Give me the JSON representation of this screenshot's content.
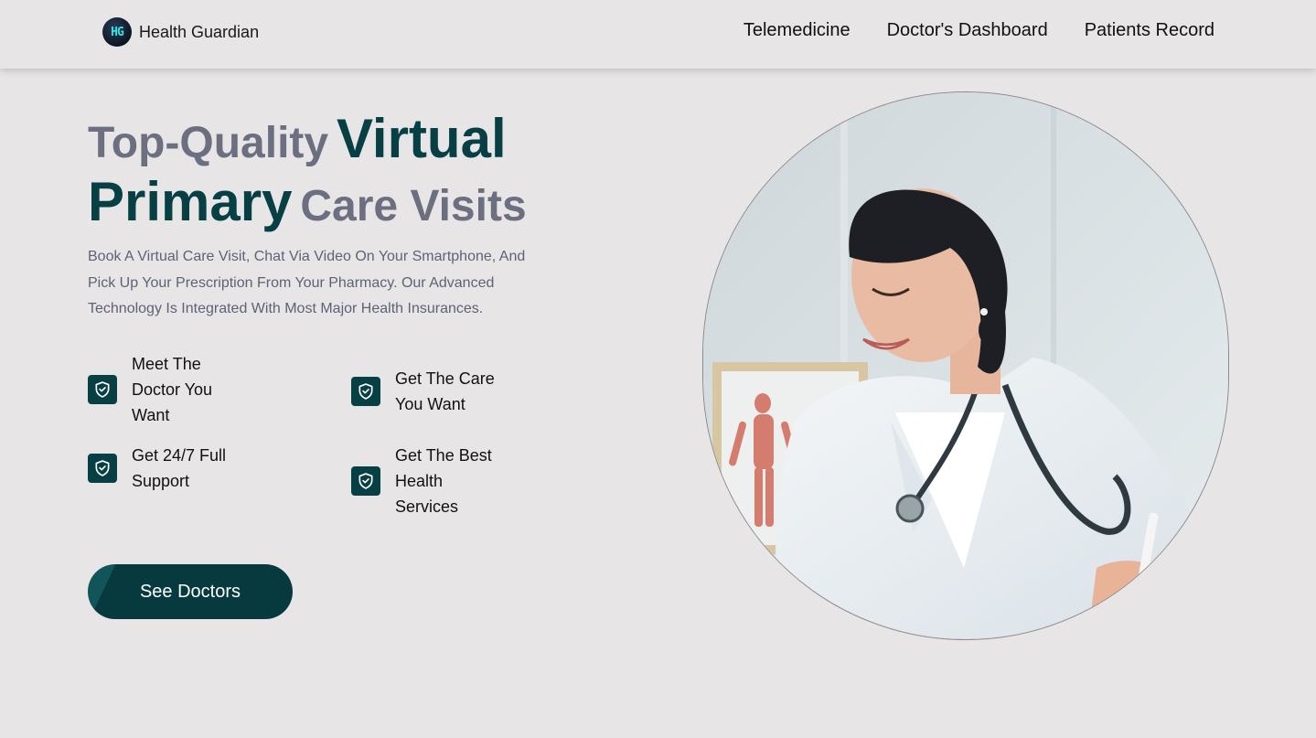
{
  "brand": {
    "logo_text": "HG",
    "name": "Health Guardian"
  },
  "nav": {
    "links": [
      "Telemedicine",
      "Doctor's Dashboard",
      "Patients Record"
    ]
  },
  "hero": {
    "headline": {
      "part1": "Top-Quality",
      "part2": "Virtual",
      "part3": "Primary",
      "part4": "Care Visits"
    },
    "description": "Book A Virtual Care Visit, Chat Via Video On Your Smartphone, And Pick Up Your Prescription From Your Pharmacy. Our Advanced Technology Is Integrated With Most Major Health Insurances.",
    "features": [
      "Meet The Doctor You Want",
      "Get The Care You Want",
      "Get 24/7 Full Support",
      "Get The Best Health Services"
    ],
    "feature_icon": "shield-check-icon",
    "cta_label": "See Doctors",
    "image": "doctor-photo"
  },
  "colors": {
    "background": "#e7e5e6",
    "accent_dark": "#064045",
    "headline_gray": "#6b6f80",
    "body_text": "#5e6275"
  }
}
